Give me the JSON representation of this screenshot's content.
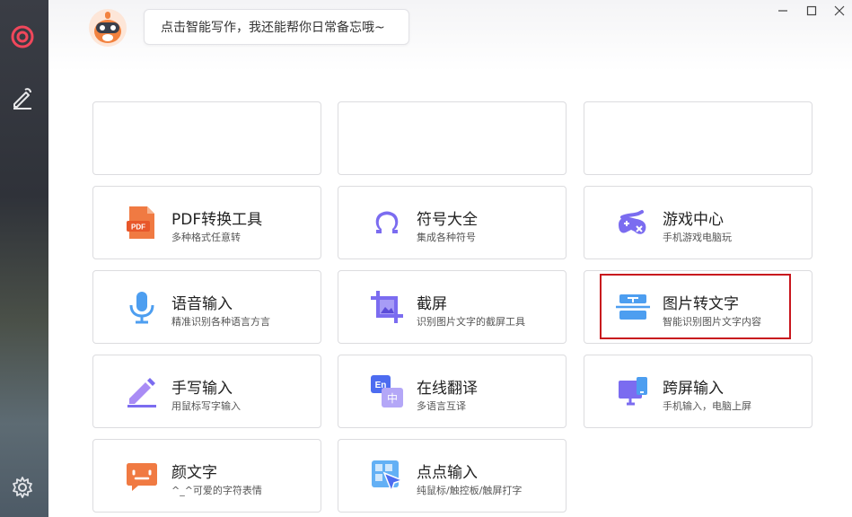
{
  "assistant": {
    "bubble_text": "点击智能写作，我还能帮你日常备忘哦~"
  },
  "sidebar": {
    "items": [
      {
        "icon": "app-logo-icon"
      },
      {
        "icon": "write-icon"
      },
      {
        "icon": "settings-icon"
      }
    ]
  },
  "window_controls": [
    "minimize-icon",
    "maximize-icon",
    "close-icon"
  ],
  "colors": {
    "highlight": "#c8161d",
    "accent_purple": "#7b6cf0",
    "accent_orange": "#f07a42",
    "accent_blue": "#4d9ef0"
  },
  "tools": [
    {
      "title": "PDF转换工具",
      "subtitle": "多种格式任意转",
      "icon": "pdf-icon"
    },
    {
      "title": "符号大全",
      "subtitle": "集成各种符号",
      "icon": "omega-icon"
    },
    {
      "title": "游戏中心",
      "subtitle": "手机游戏电脑玩",
      "icon": "gamepad-icon"
    },
    {
      "title": "语音输入",
      "subtitle": "精准识别各种语言方言",
      "icon": "microphone-icon"
    },
    {
      "title": "截屏",
      "subtitle": "识别图片文字的截屏工具",
      "icon": "screenshot-icon"
    },
    {
      "title": "图片转文字",
      "subtitle": "智能识别图片文字内容",
      "icon": "image-to-text-icon"
    },
    {
      "title": "手写输入",
      "subtitle": "用鼠标写字输入",
      "icon": "pen-icon"
    },
    {
      "title": "在线翻译",
      "subtitle": "多语言互译",
      "icon": "translate-icon"
    },
    {
      "title": "跨屏输入",
      "subtitle": "手机输入，电脑上屏",
      "icon": "cross-screen-icon"
    },
    {
      "title": "颜文字",
      "subtitle": "^_^可爱的字符表情",
      "icon": "emoticon-icon"
    },
    {
      "title": "点点输入",
      "subtitle": "纯鼠标/触控板/触屏打字",
      "icon": "click-input-icon"
    }
  ]
}
